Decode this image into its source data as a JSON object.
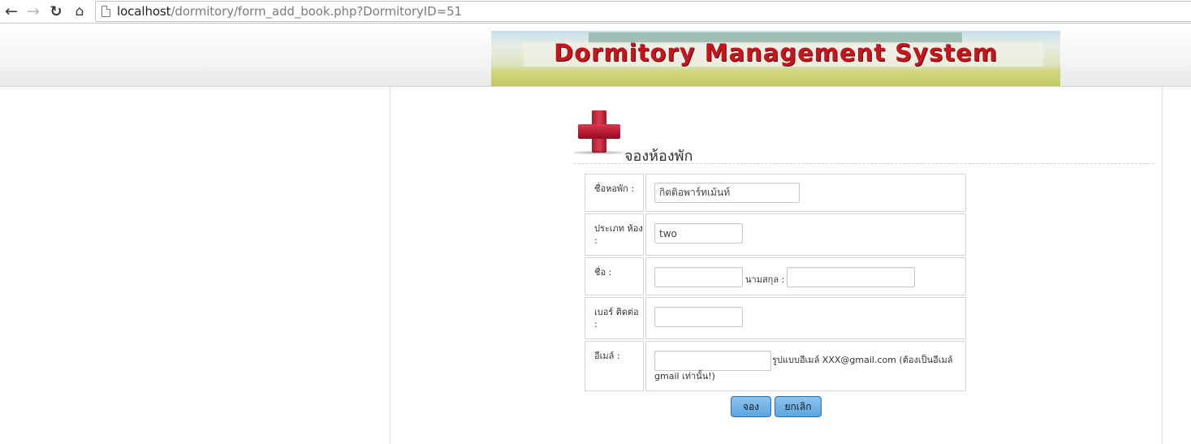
{
  "browser": {
    "url_host": "localhost",
    "url_path": "/dormitory/form_add_book.php?DormitoryID=51"
  },
  "banner": {
    "title": "Dormitory  Management System"
  },
  "page": {
    "title": "จองห้องพัก"
  },
  "form": {
    "dorm_name_label": "ชื่อหอพัก :",
    "dorm_name_value": "กิตติอพาร์ทเม้นท์",
    "room_type_label": "ประเภท ห้อง :",
    "room_type_value": "two",
    "first_name_label": "ชื่อ :",
    "first_name_value": "",
    "last_name_label": "นามสกุล :",
    "last_name_value": "",
    "phone_label": "เบอร์ ติดต่อ :",
    "phone_value": "",
    "email_label": "อีเมล์ :",
    "email_value": "",
    "email_hint": "รูปแบบอีเมล์ XXX@gmail.com (ต้องเป็นอีเมล์ gmail เท่านั้น!)"
  },
  "buttons": {
    "submit_label": "จอง",
    "cancel_label": "ยกเลิก"
  },
  "colors": {
    "banner_text": "#c4161c",
    "button_fill": "#6aaee6",
    "icon_red": "#b2172d"
  }
}
